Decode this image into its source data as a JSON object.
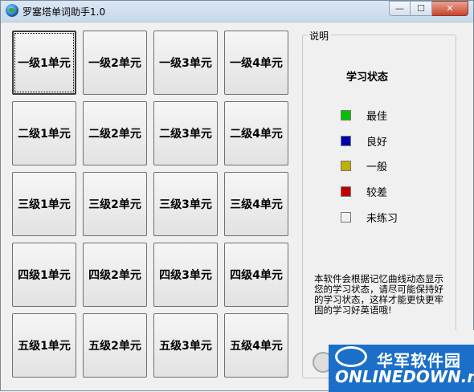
{
  "window": {
    "title": "罗塞塔单词助手1.0",
    "min_label": "—",
    "max_label": "☐",
    "close_label": "✕"
  },
  "grid": {
    "rows": [
      [
        "一级1单元",
        "一级2单元",
        "一级3单元",
        "一级4单元"
      ],
      [
        "二级1单元",
        "二级2单元",
        "二级3单元",
        "二级4单元"
      ],
      [
        "三级1单元",
        "三级2单元",
        "三级3单元",
        "三级4单元"
      ],
      [
        "四级1单元",
        "四级2单元",
        "四级3单元",
        "四级4单元"
      ],
      [
        "五级1单元",
        "五级2单元",
        "五级3单元",
        "五级4单元"
      ]
    ]
  },
  "panel": {
    "group_title": "说明",
    "status_title": "学习状态",
    "legend": [
      {
        "label": "最佳",
        "color": "#00c000"
      },
      {
        "label": "良好",
        "color": "#0000b0"
      },
      {
        "label": "一般",
        "color": "#c0b000"
      },
      {
        "label": "较差",
        "color": "#c00000"
      },
      {
        "label": "未练习",
        "color": "#f0f0f0"
      }
    ],
    "description": "本软件会根据记忆曲线动态显示您的学习状态，请尽可能保持好的学习状态，这样才能更快更牢固的学习好英语哦!"
  },
  "watermark": {
    "cn": "华军软件园",
    "en": "ONLINEDOWN.net"
  }
}
